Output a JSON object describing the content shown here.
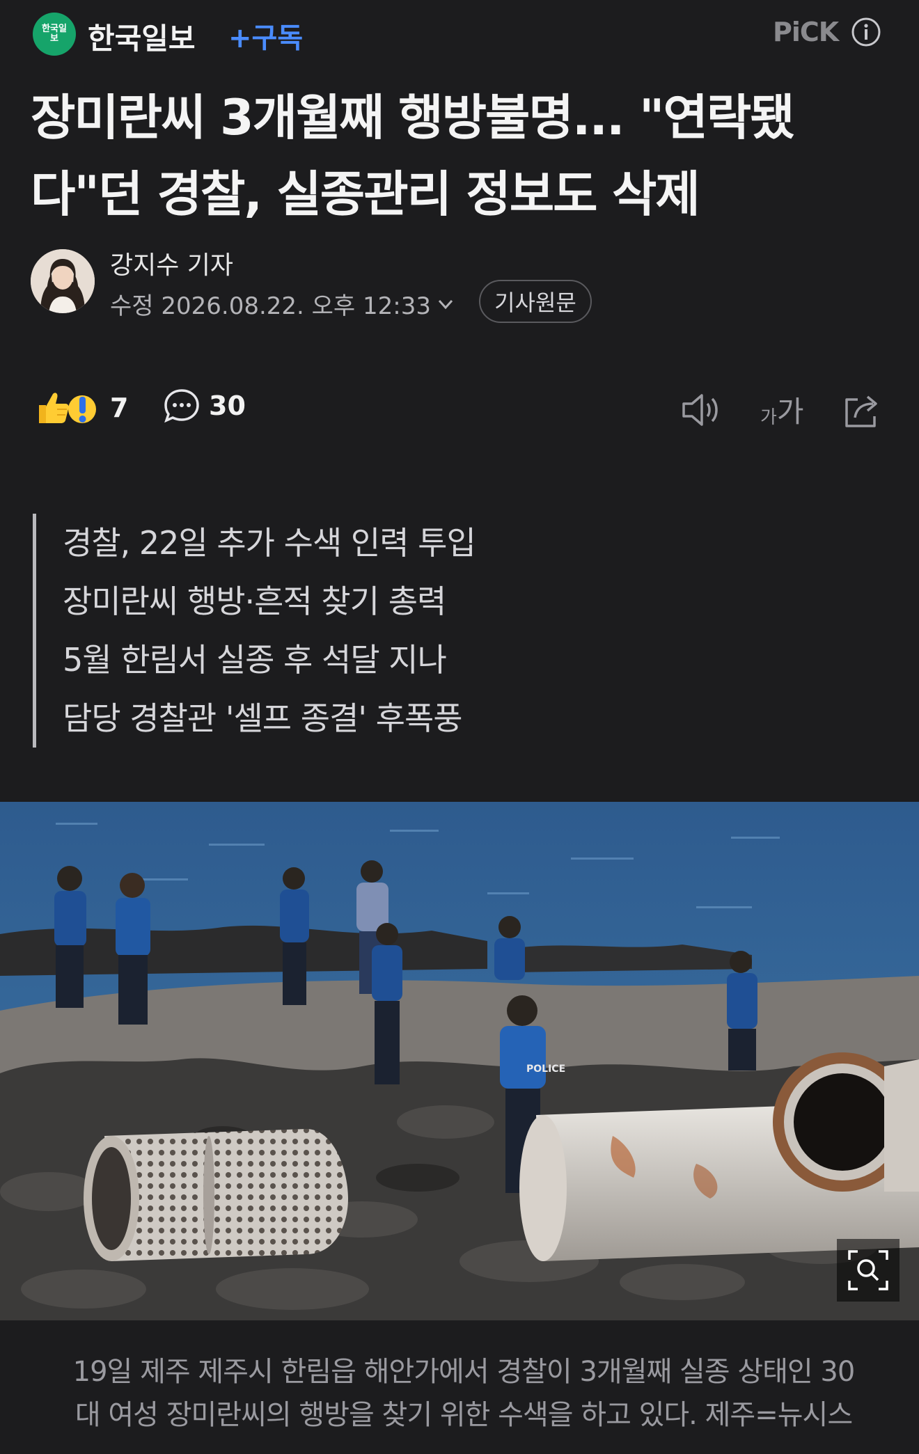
{
  "header": {
    "press_logo_text": "한국일보",
    "press_name": "한국일보",
    "subscribe_label": "+구독",
    "pick_label": "PiCK",
    "info_icon": "info-icon"
  },
  "article": {
    "headline_line1": "장미란씨 3개월째 행방불명... \"연락됐",
    "headline_line2": "다\"던 경찰, 실종관리 정보도 삭제",
    "author": "강지수 기자",
    "timestamp": "수정 2026.08.22. 오후 12:33",
    "original_button": "기사원문"
  },
  "reactions": {
    "reaction_count": "7",
    "comment_count": "30",
    "icons": [
      "thumbs-up-emoji",
      "exclamation-emoji",
      "comment-icon",
      "speaker-icon",
      "font-size-icon",
      "share-icon"
    ],
    "font_size_label_small": "가",
    "font_size_label_large": "가"
  },
  "summary": [
    "경찰, 22일 추가 수색 인력 투입",
    "장미란씨 행방·흔적 찾기 총력",
    "5월 한림서 실종 후 석달 지나",
    "담당 경찰관 '셀프 종결' 후폭풍"
  ],
  "photo": {
    "police_vest_text": "POLICE",
    "zoom_icon": "zoom-search-icon"
  },
  "caption": {
    "line1": "19일 제주 제주시 한림읍 해안가에서 경찰이 3개월째 실종 상태인 30",
    "line2": "대 여성 장미란씨의 행방을 찾기 위한 수색을 하고 있다. 제주=뉴시스"
  },
  "colors": {
    "background": "#1c1c1e",
    "brand_green": "#16a46a",
    "subscribe_blue": "#4a8cff"
  }
}
